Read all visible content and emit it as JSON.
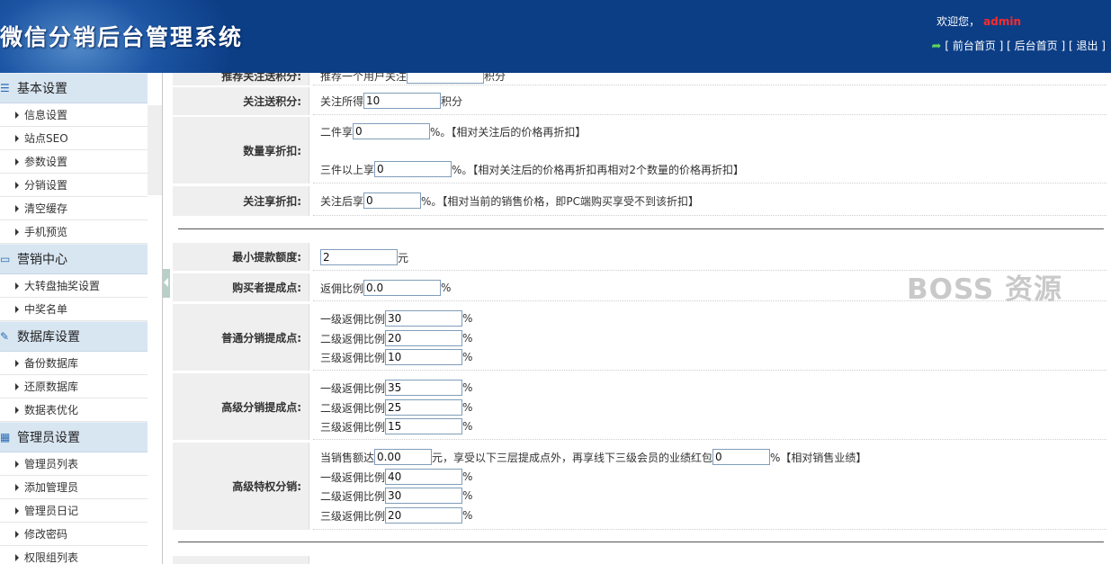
{
  "header": {
    "logo": "微信分销后台管理系统",
    "welcome_prefix": "欢迎您，",
    "username": "admin",
    "link_front": "[ 前台首页 ]",
    "link_back": "[ 后台首页 ]",
    "link_logout": "[ 退出 ]"
  },
  "sidebar": {
    "groups": [
      {
        "title": "基本设置",
        "items": [
          "信息设置",
          "站点SEO",
          "参数设置",
          "分销设置",
          "清空缓存",
          "手机预览"
        ]
      },
      {
        "title": "营销中心",
        "items": [
          "大转盘抽奖设置",
          "中奖名单"
        ]
      },
      {
        "title": "数据库设置",
        "items": [
          "备份数据库",
          "还原数据库",
          "数据表优化"
        ]
      },
      {
        "title": "管理员设置",
        "items": [
          "管理员列表",
          "添加管理员",
          "管理员日记",
          "修改密码",
          "权限组列表"
        ]
      }
    ]
  },
  "form": {
    "top_partial": {
      "label": "推荐关注送积分:",
      "text_before": "推荐一个用户关注",
      "text_after": "积分"
    },
    "follow_points": {
      "label": "关注送积分:",
      "text_before": "关注所得",
      "value": "10",
      "text_after": "积分"
    },
    "qty_discount": {
      "label": "数量享折扣:",
      "line1_before": "二件享",
      "line1_value": "0",
      "line1_after": "%。【相对关注后的价格再折扣】",
      "line2_before": "三件以上享",
      "line2_value": "0",
      "line2_after": "%。【相对关注后的价格再折扣再相对2个数量的价格再折扣】"
    },
    "follow_discount": {
      "label": "关注享折扣:",
      "text_before": "关注后享",
      "value": "0",
      "text_after": "%。【相对当前的销售价格，即PC端购买享受不到该折扣】"
    },
    "min_withdraw": {
      "label": "最小提款额度:",
      "value": "2",
      "text_after": "元"
    },
    "buyer_commission": {
      "label": "购买者提成点:",
      "text_before": "返佣比例",
      "value": "0.0",
      "text_after": "%"
    },
    "normal_commission": {
      "label": "普通分销提成点:",
      "lines": [
        {
          "text": "一级返佣比例",
          "value": "30",
          "unit": "%"
        },
        {
          "text": "二级返佣比例",
          "value": "20",
          "unit": "%"
        },
        {
          "text": "三级返佣比例",
          "value": "10",
          "unit": "%"
        }
      ]
    },
    "senior_commission": {
      "label": "高级分销提成点:",
      "lines": [
        {
          "text": "一级返佣比例",
          "value": "35",
          "unit": "%"
        },
        {
          "text": "二级返佣比例",
          "value": "25",
          "unit": "%"
        },
        {
          "text": "三级返佣比例",
          "value": "15",
          "unit": "%"
        }
      ]
    },
    "privilege": {
      "label": "高级特权分销:",
      "top_before": "当销售额达",
      "top_value": "0.00",
      "top_middle": "元，享受以下三层提成点外，再享线下三级会员的业绩红包",
      "top_value2": "0",
      "top_after": "%【相对销售业绩】",
      "lines": [
        {
          "text": "一级返佣比例",
          "value": "40",
          "unit": "%"
        },
        {
          "text": "二级返佣比例",
          "value": "30",
          "unit": "%"
        },
        {
          "text": "三级返佣比例",
          "value": "20",
          "unit": "%"
        }
      ]
    }
  },
  "watermark": "BOSS 资源"
}
